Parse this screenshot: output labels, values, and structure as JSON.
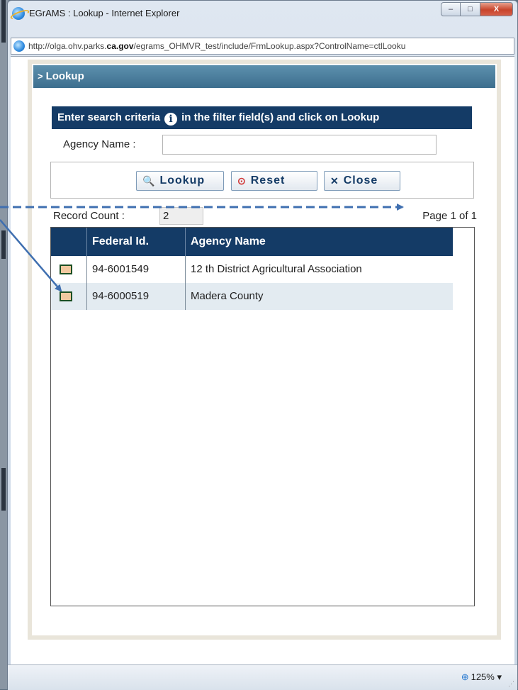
{
  "window": {
    "title": "EGrAMS : Lookup - Internet Explorer",
    "url_prefix": "http://olga.ohv.parks.",
    "url_domain": "ca.gov",
    "url_suffix": "/egrams_OHMVR_test/include/FrmLookup.aspx?ControlName=ctlLooku",
    "minimize_glyph": "–",
    "maximize_glyph": "□",
    "close_glyph": "X"
  },
  "panel": {
    "title": "Lookup",
    "chevron": ">"
  },
  "criteria": {
    "text_before": "Enter search criteria",
    "info_glyph": "i",
    "text_after": "in the filter field(s) and click on Lookup"
  },
  "filter": {
    "label": "Agency Name :",
    "value": ""
  },
  "buttons": {
    "lookup_icon": "🔍",
    "lookup": "Lookup",
    "reset_icon": "⊙",
    "reset": "Reset",
    "close_icon": "✕",
    "close": "Close"
  },
  "records": {
    "label": "Record Count :",
    "count": "2",
    "page_info": "Page 1 of 1"
  },
  "grid": {
    "headers": [
      "",
      "Federal Id.",
      "Agency Name"
    ],
    "rows": [
      {
        "federal_id": "94-6001549",
        "agency_name": "12 th District Agricultural Association"
      },
      {
        "federal_id": "94-6000519",
        "agency_name": "Madera County"
      }
    ]
  },
  "status": {
    "zoom": "125%",
    "zoom_arrow": "▾"
  },
  "colors": {
    "header_navy": "#143b66",
    "panel_header": "#4a7e9d",
    "row_alt": "#e3ebf1",
    "select_box": "#f2c9a0",
    "annotation_arrow": "#3f6fb0"
  },
  "icons": {
    "lookup": "magnifier-icon",
    "reset": "reset-circle-icon",
    "close": "close-x-icon",
    "info": "info-icon",
    "zoom": "zoom-icon",
    "browser": "ie-logo-icon"
  }
}
